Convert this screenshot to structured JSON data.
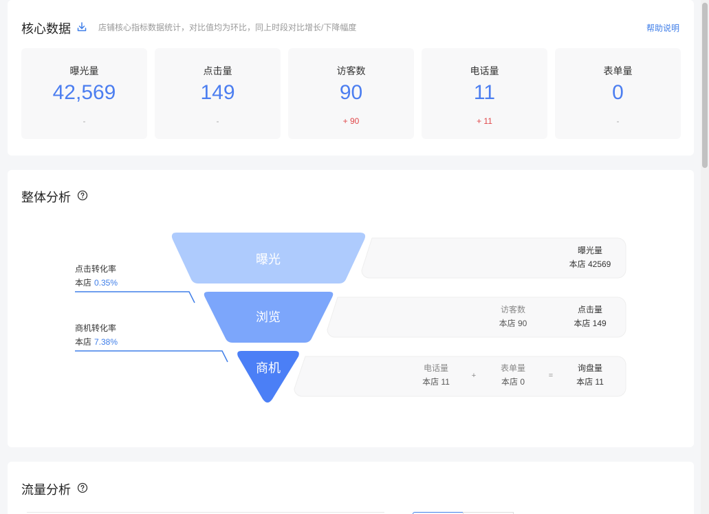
{
  "core": {
    "title": "核心数据",
    "description": "店铺核心指标数据统计，对比值均为环比，同上时段对比增长/下降幅度",
    "help_label": "帮助说明",
    "metrics": [
      {
        "label": "曝光量",
        "value": "42,569",
        "change": "-",
        "up": false
      },
      {
        "label": "点击量",
        "value": "149",
        "change": "-",
        "up": false
      },
      {
        "label": "访客数",
        "value": "90",
        "change": "+ 90",
        "up": true
      },
      {
        "label": "电话量",
        "value": "11",
        "change": "+ 11",
        "up": true
      },
      {
        "label": "表单量",
        "value": "0",
        "change": "-",
        "up": false
      }
    ]
  },
  "overall": {
    "title": "整体分析",
    "funnel": {
      "stages": [
        "曝光",
        "浏览",
        "商机"
      ],
      "click_rate_label": "点击转化率",
      "click_rate_value_prefix": "本店",
      "click_rate_value": "0.35%",
      "biz_rate_label": "商机转化率",
      "biz_rate_value_prefix": "本店",
      "biz_rate_value": "7.38%",
      "row1": {
        "label": "曝光量",
        "value": "本店 42569"
      },
      "row2": [
        {
          "label": "访客数",
          "value": "本店 90"
        },
        {
          "label": "点击量",
          "value": "本店 149"
        }
      ],
      "row3": [
        {
          "label": "电话量",
          "value": "本店 11"
        },
        {
          "op": "+"
        },
        {
          "label": "表单量",
          "value": "本店 0"
        },
        {
          "op": "="
        },
        {
          "label": "询盘量",
          "value": "本店 11"
        }
      ]
    },
    "colors": {
      "stage1": "#aecbfd",
      "stage2": "#7ca6fb",
      "stage3": "#4b7ff6",
      "accent": "#3f7ee8"
    }
  },
  "traffic": {
    "title": "流量分析"
  }
}
